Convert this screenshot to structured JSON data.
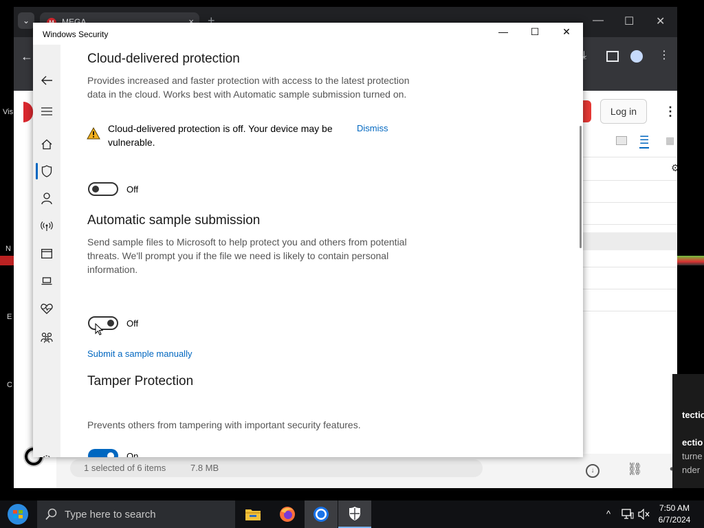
{
  "browser": {
    "tab_title": "MEGA",
    "tab_close": "×",
    "new_tab": "+",
    "login_label": "Log in",
    "status_selection": "1 selected of 6 items",
    "status_size": "7.8 MB"
  },
  "desktop": {
    "icon_labels": [
      "Vis",
      "N",
      "E",
      "C"
    ]
  },
  "side_panel": {
    "lines": [
      "tectio",
      "ectio",
      "turne",
      "nder"
    ]
  },
  "window": {
    "title": "Windows Security",
    "minimize": "—",
    "maximize": "☐",
    "close": "✕"
  },
  "nav": {
    "items": [
      "back",
      "menu",
      "home",
      "virus-threat-protection",
      "account-protection",
      "firewall-network",
      "app-browser-control",
      "device-security",
      "device-performance-health",
      "family-options",
      "settings"
    ]
  },
  "cloud": {
    "heading": "Cloud-delivered protection",
    "description": "Provides increased and faster protection with access to the latest protection data in the cloud. Works best with Automatic sample submission turned on.",
    "warning": "Cloud-delivered protection is off. Your device may be vulnerable.",
    "dismiss": "Dismiss",
    "toggle_state": "Off"
  },
  "sample": {
    "heading": "Automatic sample submission",
    "description": "Send sample files to Microsoft to help protect you and others from potential threats. We'll prompt you if the file we need is likely to contain personal information.",
    "toggle_state": "Off",
    "link": "Submit a sample manually"
  },
  "tamper": {
    "heading": "Tamper Protection",
    "description": "Prevents others from tampering with important security features.",
    "toggle_state": "On"
  },
  "taskbar": {
    "search_placeholder": "Type here to search",
    "time": "7:50 AM",
    "date": "6/7/2024",
    "tray_chevron": "^"
  },
  "colors": {
    "accent": "#0067c0",
    "warning": "#f2b01e",
    "taskbar": "#101114"
  }
}
